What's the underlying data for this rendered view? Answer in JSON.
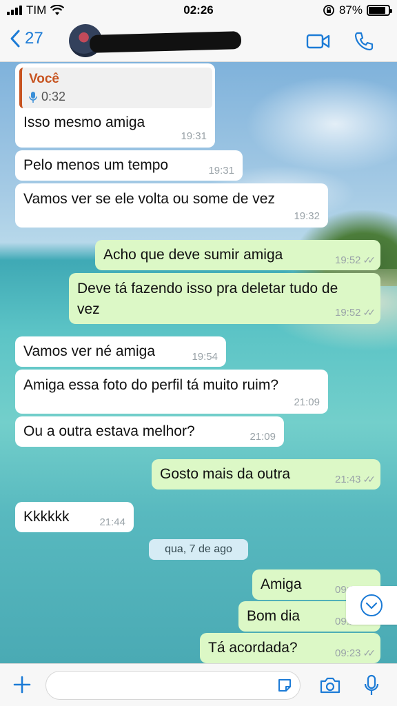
{
  "status_bar": {
    "carrier": "TIM",
    "time": "02:26",
    "battery": "87%",
    "battery_level": 0.87
  },
  "header": {
    "back_count": "27"
  },
  "messages": [
    {
      "direction": "in",
      "quote_author": "Você",
      "quote_audio": "0:32",
      "text": "Isso mesmo amiga",
      "time": "19:31"
    },
    {
      "direction": "in",
      "text": "Pelo menos um tempo",
      "time": "19:31"
    },
    {
      "direction": "in",
      "text": "Vamos ver se ele volta ou some de vez",
      "time": "19:32"
    },
    {
      "direction": "out",
      "text": "Acho que deve sumir amiga",
      "time": "19:52"
    },
    {
      "direction": "out",
      "text": "Deve tá fazendo isso pra deletar tudo de",
      "text2": "vez",
      "time": "19:52"
    },
    {
      "direction": "in",
      "text": "Vamos ver né amiga",
      "time": "19:54"
    },
    {
      "direction": "in",
      "text": "Amiga essa foto do perfil tá muito ruim?",
      "time": "21:09"
    },
    {
      "direction": "in",
      "text": "Ou a outra estava melhor?",
      "time": "21:09"
    },
    {
      "direction": "out",
      "text": "Gosto mais da outra",
      "time": "21:43"
    },
    {
      "direction": "in",
      "text": "Kkkkkk",
      "time": "21:44"
    },
    {
      "direction": "out",
      "text": "Amiga",
      "time": "09:22"
    },
    {
      "direction": "out",
      "text": "Bom dia",
      "time": "09:22"
    },
    {
      "direction": "out",
      "text": "Tá acordada?",
      "time": "09:23"
    }
  ],
  "date_separator": "qua, 7 de ago",
  "colors": {
    "accent": "#1c7bd6",
    "outgoing_bubble": "#dcf8c6",
    "incoming_bubble": "#ffffff",
    "quote_author": "#c7531f"
  },
  "icons": {
    "back": "chevron-left-icon",
    "video": "video-call-icon",
    "phone": "phone-icon",
    "plus": "plus-icon",
    "sticker": "sticker-icon",
    "camera": "camera-icon",
    "mic": "microphone-icon",
    "scroll": "scroll-down-icon"
  }
}
